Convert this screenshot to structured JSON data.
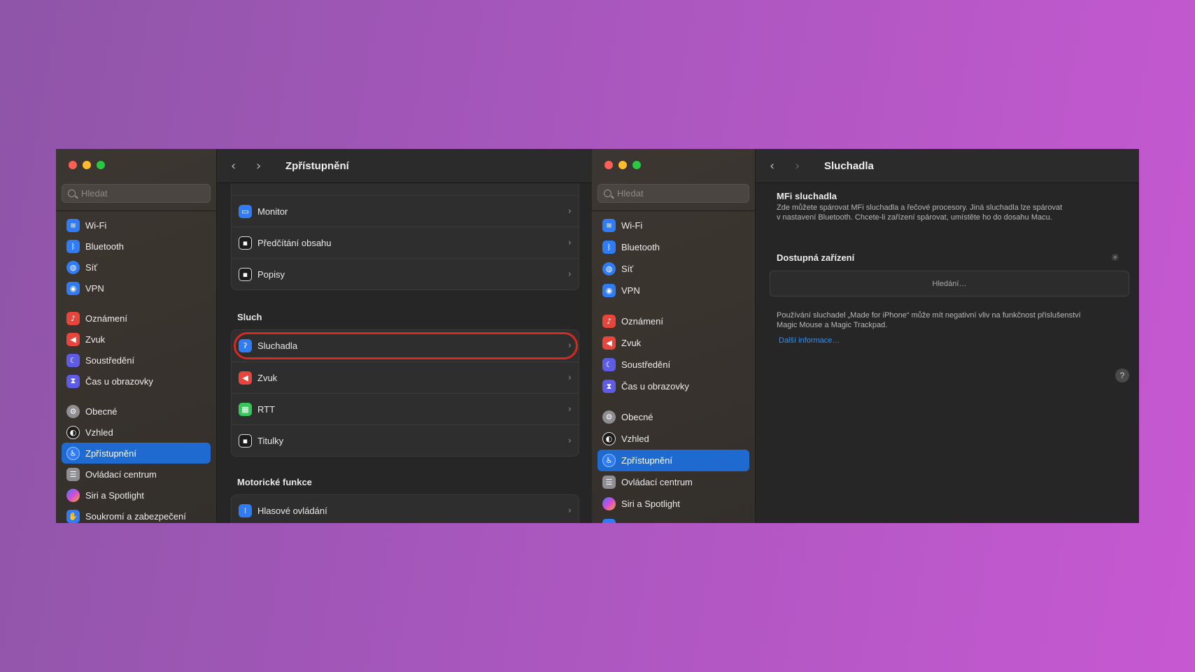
{
  "colors": {
    "accent": "#1f6ad1",
    "highlight_ring": "#d42a22",
    "link": "#3a8ee6"
  },
  "left_window": {
    "search_placeholder": "Hledat",
    "sidebar": [
      {
        "label": "Wi-Fi",
        "icon": "wifi-icon",
        "color": "#2f7cf6"
      },
      {
        "label": "Bluetooth",
        "icon": "bluetooth-icon",
        "color": "#2f7cf6"
      },
      {
        "label": "Síť",
        "icon": "globe-icon",
        "color": "#2f7cf6"
      },
      {
        "label": "VPN",
        "icon": "vpn-icon",
        "color": "#2f7cf6"
      },
      {
        "label": "Oznámení",
        "icon": "bell-icon",
        "color": "#e8453c"
      },
      {
        "label": "Zvuk",
        "icon": "speaker-icon",
        "color": "#e8453c"
      },
      {
        "label": "Soustředění",
        "icon": "moon-icon",
        "color": "#5e5ce6"
      },
      {
        "label": "Čas u obrazovky",
        "icon": "hourglass-icon",
        "color": "#5e5ce6"
      },
      {
        "label": "Obecné",
        "icon": "gear-icon",
        "color": "#8e8e93"
      },
      {
        "label": "Vzhled",
        "icon": "appearance-icon",
        "color": "#1c1c1c"
      },
      {
        "label": "Zpřístupnění",
        "icon": "accessibility-icon",
        "color": "#2f7cf6"
      },
      {
        "label": "Ovládací centrum",
        "icon": "control-center-icon",
        "color": "#8e8e93"
      },
      {
        "label": "Siri a Spotlight",
        "icon": "siri-icon",
        "color": "#b44bd6"
      },
      {
        "label": "Soukromí a zabezpečení",
        "icon": "hand-icon",
        "color": "#2f7cf6"
      }
    ],
    "toolbar_title": "Zpřístupnění",
    "vision_rows": [
      {
        "label": "Monitor",
        "icon": "display-icon",
        "color": "#2f7cf6"
      },
      {
        "label": "Předčítání obsahu",
        "icon": "speech-bubble-icon",
        "color": "#1c1c1c"
      },
      {
        "label": "Popisy",
        "icon": "caption-bubble-icon",
        "color": "#1c1c1c"
      }
    ],
    "hearing_title": "Sluch",
    "hearing_rows": [
      {
        "label": "Sluchadla",
        "icon": "ear-icon",
        "color": "#2f7cf6"
      },
      {
        "label": "Zvuk",
        "icon": "speaker-icon",
        "color": "#e8453c"
      },
      {
        "label": "RTT",
        "icon": "rtt-icon",
        "color": "#34c759"
      },
      {
        "label": "Titulky",
        "icon": "subtitles-icon",
        "color": "#1c1c1c"
      }
    ],
    "motor_title": "Motorické funkce",
    "motor_rows": [
      {
        "label": "Hlasové ovládání",
        "icon": "waveform-icon",
        "color": "#2f7cf6"
      }
    ]
  },
  "right_window": {
    "search_placeholder": "Hledat",
    "sidebar": [
      {
        "label": "Wi-Fi",
        "icon": "wifi-icon",
        "color": "#2f7cf6"
      },
      {
        "label": "Bluetooth",
        "icon": "bluetooth-icon",
        "color": "#2f7cf6"
      },
      {
        "label": "Síť",
        "icon": "globe-icon",
        "color": "#2f7cf6"
      },
      {
        "label": "VPN",
        "icon": "vpn-icon",
        "color": "#2f7cf6"
      },
      {
        "label": "Oznámení",
        "icon": "bell-icon",
        "color": "#e8453c"
      },
      {
        "label": "Zvuk",
        "icon": "speaker-icon",
        "color": "#e8453c"
      },
      {
        "label": "Soustředění",
        "icon": "moon-icon",
        "color": "#5e5ce6"
      },
      {
        "label": "Čas u obrazovky",
        "icon": "hourglass-icon",
        "color": "#5e5ce6"
      },
      {
        "label": "Obecné",
        "icon": "gear-icon",
        "color": "#8e8e93"
      },
      {
        "label": "Vzhled",
        "icon": "appearance-icon",
        "color": "#1c1c1c"
      },
      {
        "label": "Zpřístupnění",
        "icon": "accessibility-icon",
        "color": "#2f7cf6"
      },
      {
        "label": "Ovládací centrum",
        "icon": "control-center-icon",
        "color": "#8e8e93"
      },
      {
        "label": "Siri a Spotlight",
        "icon": "siri-icon",
        "color": "#b44bd6"
      }
    ],
    "toolbar_title": "Sluchadla",
    "mfi_title": "MFi sluchadla",
    "mfi_text_line1": "Zde můžete spárovat MFi sluchadla a řečové procesory. Jiná sluchadla lze spárovat",
    "mfi_text_line2": "v nastavení Bluetooth. Chcete-li zařízení spárovat, umístěte ho do dosahu Macu.",
    "devices_title": "Dostupná zařízení",
    "searching": "Hledání…",
    "note_line1": "Používání sluchadel „Made for iPhone“ může mít negativní vliv na funkčnost příslušenství",
    "note_line2": "Magic Mouse a Magic Trackpad.",
    "more_info": "Další informace…",
    "help": "?"
  }
}
